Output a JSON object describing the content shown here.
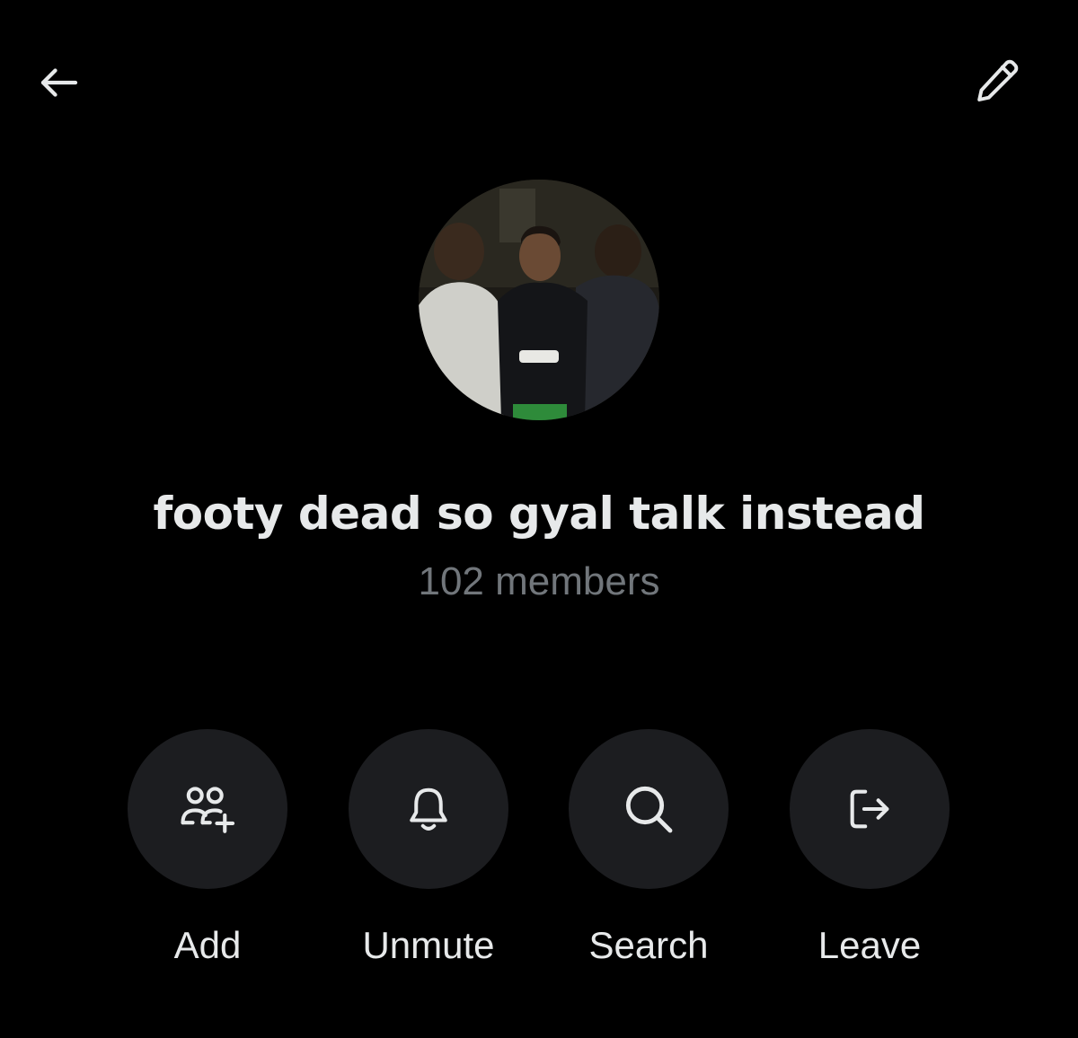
{
  "header": {
    "back_icon": "arrow-left-icon",
    "edit_icon": "pencil-icon"
  },
  "group": {
    "avatar_description": "group-photo",
    "name": "footy dead so gyal talk instead",
    "members": "102 members"
  },
  "actions": [
    {
      "label": "Add",
      "icon": "add-people-icon"
    },
    {
      "label": "Unmute",
      "icon": "bell-icon"
    },
    {
      "label": "Search",
      "icon": "search-icon"
    },
    {
      "label": "Leave",
      "icon": "leave-icon"
    }
  ],
  "colors": {
    "background": "#000000",
    "primary_text": "#e7e9ea",
    "secondary_text": "#71767b",
    "button_fill": "#1c1d20"
  }
}
